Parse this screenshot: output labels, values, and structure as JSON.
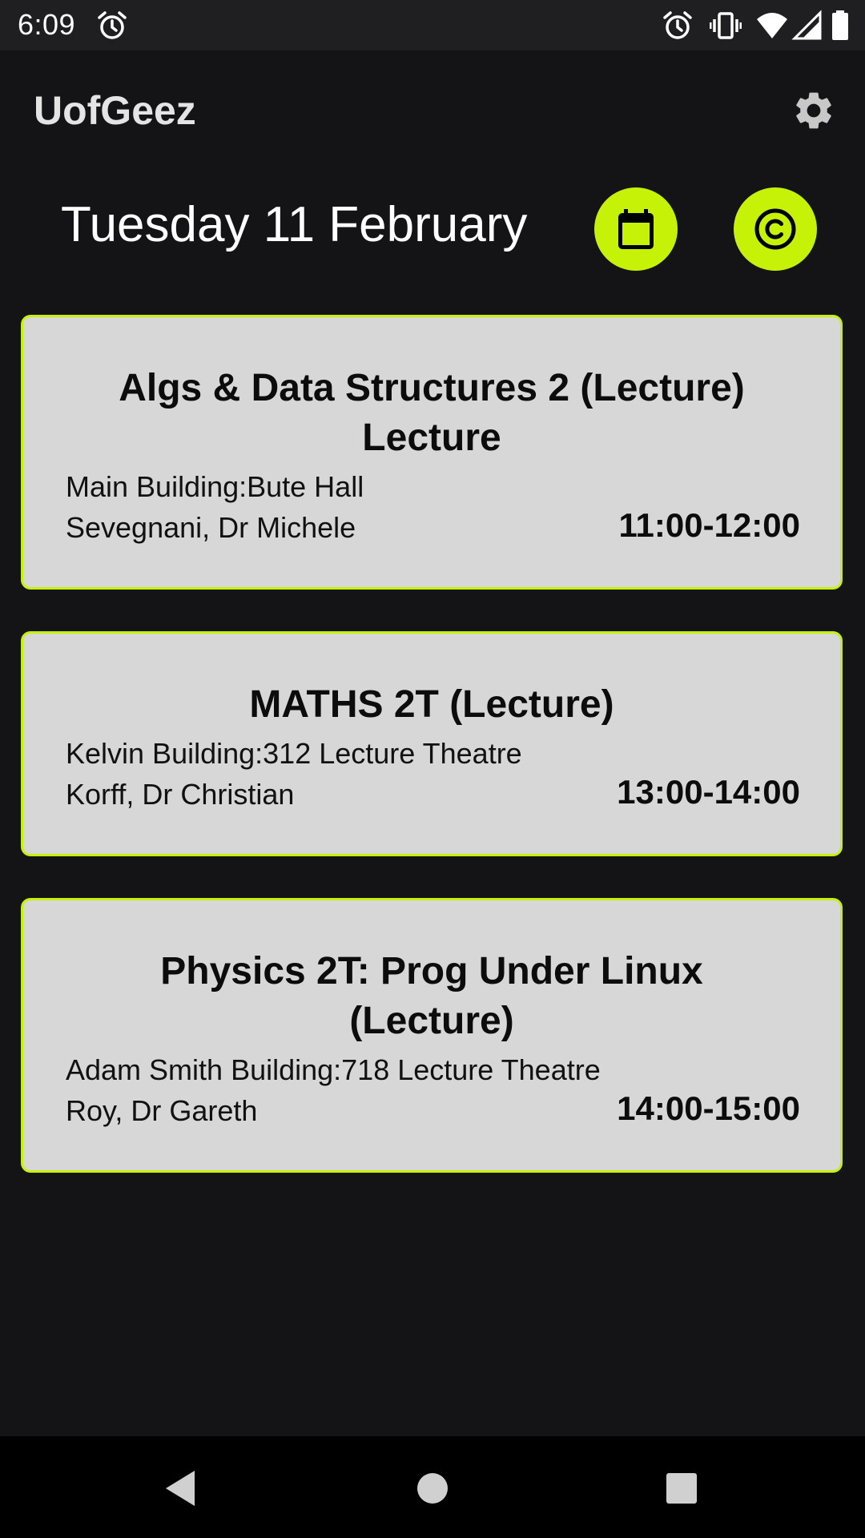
{
  "status_bar": {
    "time": "6:09",
    "icons": [
      "alarm-icon",
      "alarm-icon",
      "vibrate-icon",
      "wifi-icon",
      "signal-icon",
      "battery-icon"
    ]
  },
  "app_bar": {
    "title": "UofGeez",
    "settings_icon": "gear-icon"
  },
  "header": {
    "date": "Tuesday 11 February",
    "calendar_button_icon": "calendar-icon",
    "copyright_button_icon": "copyright-icon"
  },
  "lectures": [
    {
      "title_line1": "Algs & Data Structures 2 (Lecture)",
      "title_line2": "Lecture",
      "location": "Main Building:Bute Hall",
      "lecturer": "Sevegnani, Dr Michele",
      "time": "11:00-12:00"
    },
    {
      "title_line1": "MATHS 2T (Lecture)",
      "title_line2": "",
      "location": "Kelvin Building:312 Lecture Theatre",
      "lecturer": "Korff, Dr Christian",
      "time": "13:00-14:00"
    },
    {
      "title_line1": "Physics 2T: Prog Under Linux",
      "title_line2": "(Lecture)",
      "location": "Adam Smith Building:718 Lecture Theatre",
      "lecturer": "Roy, Dr Gareth",
      "time": "14:00-15:00"
    }
  ],
  "nav_bar": {
    "icons": [
      "back-icon",
      "home-icon",
      "recents-icon"
    ]
  },
  "colors": {
    "accent": "#c6f207",
    "background": "#141416",
    "card": "#d7d7d7",
    "status_bar": "#1f1f22"
  }
}
